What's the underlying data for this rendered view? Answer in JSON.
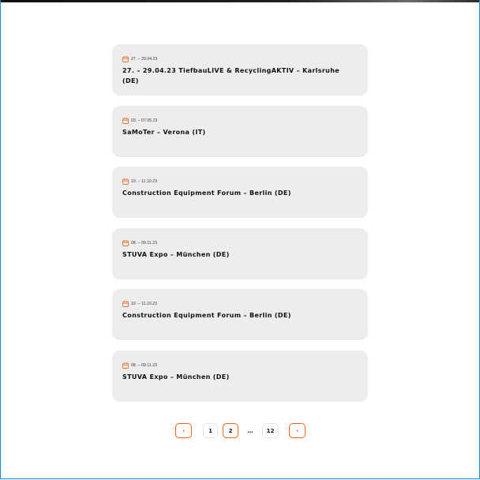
{
  "events": [
    {
      "date": "27. – 29.04.23",
      "title": "27. – 29.04.23 TiefbauLIVE & RecyclingAKTIV – Karlsruhe (DE)"
    },
    {
      "date": "03. – 07.05.23",
      "title": "SaMoTer – Verona (IT)"
    },
    {
      "date": "10. – 11.10.23",
      "title": "Construction Equipment Forum – Berlin (DE)"
    },
    {
      "date": "08. – 09.11.23",
      "title": "STUVA Expo – München (DE)"
    },
    {
      "date": "10. – 11.10.23",
      "title": "Construction Equipment Forum – Berlin (DE)"
    },
    {
      "date": "08. – 09.11.23",
      "title": "STUVA Expo – München (DE)"
    }
  ],
  "pagination": {
    "prev_label": "‹",
    "next_label": "›",
    "pages": [
      "1",
      "2",
      "…",
      "12"
    ],
    "current_page": "2"
  },
  "colors": {
    "accent": "#e8621c",
    "card_bg": "#ededed",
    "frame_border": "#1f8ad8"
  },
  "icons": {
    "event_date": "calendar-icon",
    "prev": "chevron-left-icon",
    "next": "chevron-right-icon"
  }
}
